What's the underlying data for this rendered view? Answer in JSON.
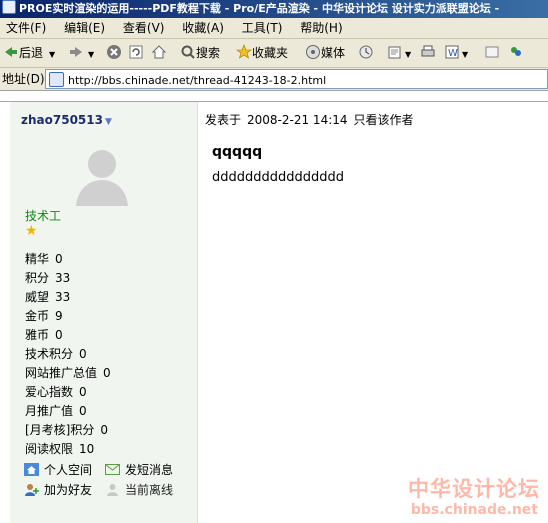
{
  "window": {
    "title": "PROE实时渲染的运用-----PDF教程下载 - Pro/E产品渲染 - 中华设计论坛 设计实力派联盟论坛 -"
  },
  "menu": [
    "文件(F)",
    "编辑(E)",
    "查看(V)",
    "收藏(A)",
    "工具(T)",
    "帮助(H)"
  ],
  "toolbar": {
    "back": "后退",
    "search": "搜索",
    "favorites": "收藏夹",
    "media": "媒体"
  },
  "address": {
    "label": "地址(D)",
    "url": "http://bbs.chinade.net/thread-41243-18-2.html"
  },
  "user": {
    "name": "zhao750513",
    "rank": "技术工",
    "stats": [
      {
        "label": "精华",
        "value": "0"
      },
      {
        "label": "积分",
        "value": "33"
      },
      {
        "label": "威望",
        "value": "33"
      },
      {
        "label": "金币",
        "value": "9"
      },
      {
        "label": "雅币",
        "value": "0"
      },
      {
        "label": "技术积分",
        "value": "0"
      },
      {
        "label": "网站推广总值",
        "value": "0"
      },
      {
        "label": "爱心指数",
        "value": "0"
      },
      {
        "label": "月推广值",
        "value": "0"
      },
      {
        "label": "[月考核]积分",
        "value": "0"
      },
      {
        "label": "阅读权限",
        "value": "10"
      }
    ],
    "actions": {
      "space": "个人空间",
      "message": "发短消息",
      "add_friend": "加为好友",
      "status": "当前离线"
    }
  },
  "post": {
    "posted_label": "发表于",
    "date": "2008-2-21 14:14",
    "author_only": "只看该作者",
    "title": "qqqqq",
    "body": "dddddddddddddddd"
  },
  "watermark": {
    "line1": "中华设计论坛",
    "line2": "bbs.chinade.net"
  },
  "colors": {
    "titlebar": "#0a246a",
    "chrome": "#ece9d8",
    "sidebar": "#f0f5f0",
    "rank": "#118811",
    "watermark": "#ffb8a8"
  }
}
